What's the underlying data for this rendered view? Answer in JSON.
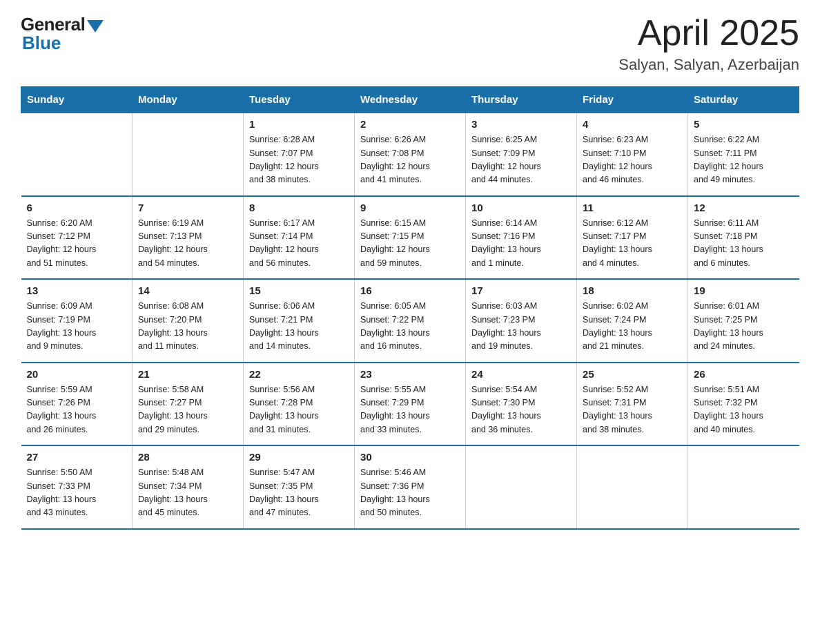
{
  "logo": {
    "general": "General",
    "blue": "Blue"
  },
  "title": {
    "month_year": "April 2025",
    "location": "Salyan, Salyan, Azerbaijan"
  },
  "weekdays": [
    "Sunday",
    "Monday",
    "Tuesday",
    "Wednesday",
    "Thursday",
    "Friday",
    "Saturday"
  ],
  "weeks": [
    [
      {
        "day": "",
        "info": ""
      },
      {
        "day": "",
        "info": ""
      },
      {
        "day": "1",
        "info": "Sunrise: 6:28 AM\nSunset: 7:07 PM\nDaylight: 12 hours\nand 38 minutes."
      },
      {
        "day": "2",
        "info": "Sunrise: 6:26 AM\nSunset: 7:08 PM\nDaylight: 12 hours\nand 41 minutes."
      },
      {
        "day": "3",
        "info": "Sunrise: 6:25 AM\nSunset: 7:09 PM\nDaylight: 12 hours\nand 44 minutes."
      },
      {
        "day": "4",
        "info": "Sunrise: 6:23 AM\nSunset: 7:10 PM\nDaylight: 12 hours\nand 46 minutes."
      },
      {
        "day": "5",
        "info": "Sunrise: 6:22 AM\nSunset: 7:11 PM\nDaylight: 12 hours\nand 49 minutes."
      }
    ],
    [
      {
        "day": "6",
        "info": "Sunrise: 6:20 AM\nSunset: 7:12 PM\nDaylight: 12 hours\nand 51 minutes."
      },
      {
        "day": "7",
        "info": "Sunrise: 6:19 AM\nSunset: 7:13 PM\nDaylight: 12 hours\nand 54 minutes."
      },
      {
        "day": "8",
        "info": "Sunrise: 6:17 AM\nSunset: 7:14 PM\nDaylight: 12 hours\nand 56 minutes."
      },
      {
        "day": "9",
        "info": "Sunrise: 6:15 AM\nSunset: 7:15 PM\nDaylight: 12 hours\nand 59 minutes."
      },
      {
        "day": "10",
        "info": "Sunrise: 6:14 AM\nSunset: 7:16 PM\nDaylight: 13 hours\nand 1 minute."
      },
      {
        "day": "11",
        "info": "Sunrise: 6:12 AM\nSunset: 7:17 PM\nDaylight: 13 hours\nand 4 minutes."
      },
      {
        "day": "12",
        "info": "Sunrise: 6:11 AM\nSunset: 7:18 PM\nDaylight: 13 hours\nand 6 minutes."
      }
    ],
    [
      {
        "day": "13",
        "info": "Sunrise: 6:09 AM\nSunset: 7:19 PM\nDaylight: 13 hours\nand 9 minutes."
      },
      {
        "day": "14",
        "info": "Sunrise: 6:08 AM\nSunset: 7:20 PM\nDaylight: 13 hours\nand 11 minutes."
      },
      {
        "day": "15",
        "info": "Sunrise: 6:06 AM\nSunset: 7:21 PM\nDaylight: 13 hours\nand 14 minutes."
      },
      {
        "day": "16",
        "info": "Sunrise: 6:05 AM\nSunset: 7:22 PM\nDaylight: 13 hours\nand 16 minutes."
      },
      {
        "day": "17",
        "info": "Sunrise: 6:03 AM\nSunset: 7:23 PM\nDaylight: 13 hours\nand 19 minutes."
      },
      {
        "day": "18",
        "info": "Sunrise: 6:02 AM\nSunset: 7:24 PM\nDaylight: 13 hours\nand 21 minutes."
      },
      {
        "day": "19",
        "info": "Sunrise: 6:01 AM\nSunset: 7:25 PM\nDaylight: 13 hours\nand 24 minutes."
      }
    ],
    [
      {
        "day": "20",
        "info": "Sunrise: 5:59 AM\nSunset: 7:26 PM\nDaylight: 13 hours\nand 26 minutes."
      },
      {
        "day": "21",
        "info": "Sunrise: 5:58 AM\nSunset: 7:27 PM\nDaylight: 13 hours\nand 29 minutes."
      },
      {
        "day": "22",
        "info": "Sunrise: 5:56 AM\nSunset: 7:28 PM\nDaylight: 13 hours\nand 31 minutes."
      },
      {
        "day": "23",
        "info": "Sunrise: 5:55 AM\nSunset: 7:29 PM\nDaylight: 13 hours\nand 33 minutes."
      },
      {
        "day": "24",
        "info": "Sunrise: 5:54 AM\nSunset: 7:30 PM\nDaylight: 13 hours\nand 36 minutes."
      },
      {
        "day": "25",
        "info": "Sunrise: 5:52 AM\nSunset: 7:31 PM\nDaylight: 13 hours\nand 38 minutes."
      },
      {
        "day": "26",
        "info": "Sunrise: 5:51 AM\nSunset: 7:32 PM\nDaylight: 13 hours\nand 40 minutes."
      }
    ],
    [
      {
        "day": "27",
        "info": "Sunrise: 5:50 AM\nSunset: 7:33 PM\nDaylight: 13 hours\nand 43 minutes."
      },
      {
        "day": "28",
        "info": "Sunrise: 5:48 AM\nSunset: 7:34 PM\nDaylight: 13 hours\nand 45 minutes."
      },
      {
        "day": "29",
        "info": "Sunrise: 5:47 AM\nSunset: 7:35 PM\nDaylight: 13 hours\nand 47 minutes."
      },
      {
        "day": "30",
        "info": "Sunrise: 5:46 AM\nSunset: 7:36 PM\nDaylight: 13 hours\nand 50 minutes."
      },
      {
        "day": "",
        "info": ""
      },
      {
        "day": "",
        "info": ""
      },
      {
        "day": "",
        "info": ""
      }
    ]
  ]
}
